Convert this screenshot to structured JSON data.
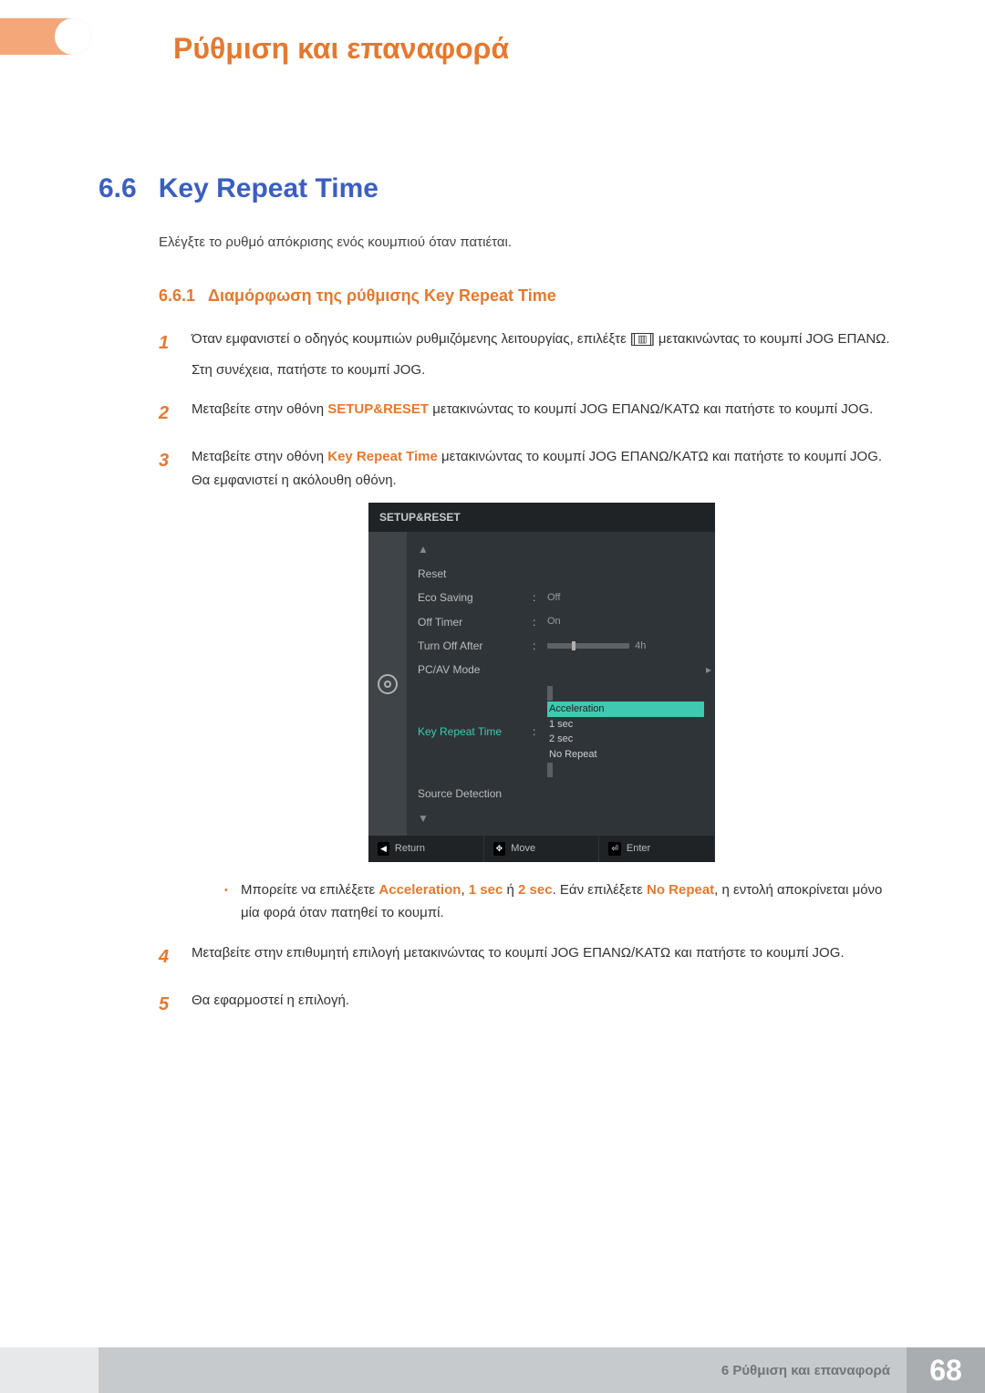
{
  "chapter_header": "Ρύθμιση και επαναφορά",
  "section": {
    "num": "6.6",
    "title": "Key Repeat Time"
  },
  "intro": "Ελέγξτε το ρυθμό απόκρισης ενός κουμπιού όταν πατιέται.",
  "subsection": {
    "num": "6.6.1",
    "title": "Διαμόρφωση της ρύθμισης Key Repeat Time"
  },
  "steps": {
    "s1a": "Όταν εμφανιστεί ο οδηγός κουμπιών ρυθμιζόμενης λειτουργίας, επιλέξτε [",
    "s1_icon": "▥",
    "s1b": "] μετακινώντας το κουμπί JOG ΕΠΑΝΩ.",
    "s1c": "Στη συνέχεια, πατήστε το κουμπί JOG.",
    "s2a": "Μεταβείτε στην οθόνη ",
    "s2_hl": "SETUP&RESET",
    "s2b": " μετακινώντας το κουμπί JOG ΕΠΑΝΩ/ΚΑΤΩ και πατήστε το κουμπί JOG.",
    "s3a": "Μεταβείτε στην οθόνη ",
    "s3_hl": "Key Repeat Time",
    "s3b": " μετακινώντας το κουμπί JOG ΕΠΑΝΩ/ΚΑΤΩ και πατήστε το κουμπί JOG. Θα εμφανιστεί η ακόλουθη οθόνη.",
    "bullet_a": "Μπορείτε να επιλέξετε ",
    "bullet_hl1": "Acceleration",
    "bullet_sep1": ", ",
    "bullet_hl2": "1 sec",
    "bullet_sep2": " ή ",
    "bullet_hl3": "2 sec",
    "bullet_mid": ". Εάν επιλέξετε ",
    "bullet_hl4": "No Repeat",
    "bullet_b": ", η εντολή αποκρίνεται μόνο μία φορά όταν πατηθεί το κουμπί.",
    "s4": "Μεταβείτε στην επιθυμητή επιλογή μετακινώντας το κουμπί JOG ΕΠΑΝΩ/ΚΑΤΩ και πατήστε το κουμπί JOG.",
    "s5": "Θα εφαρμοστεί η επιλογή."
  },
  "step_nums": {
    "n1": "1",
    "n2": "2",
    "n3": "3",
    "n4": "4",
    "n5": "5"
  },
  "osd": {
    "title": "SETUP&RESET",
    "items": [
      {
        "label": "Reset",
        "value": ""
      },
      {
        "label": "Eco Saving",
        "value": "Off"
      },
      {
        "label": "Off Timer",
        "value": "On"
      },
      {
        "label": "Turn Off After",
        "value": "4h"
      },
      {
        "label": "PC/AV Mode",
        "value": ""
      },
      {
        "label": "Key Repeat Time",
        "value": ""
      },
      {
        "label": "Source Detection",
        "value": ""
      }
    ],
    "dropdown": [
      "Acceleration",
      "1 sec",
      "2 sec",
      "No Repeat"
    ],
    "footer": {
      "return": "Return",
      "move": "Move",
      "enter": "Enter"
    }
  },
  "footer": {
    "chapter": "6 Ρύθμιση και επαναφορά",
    "page": "68"
  }
}
